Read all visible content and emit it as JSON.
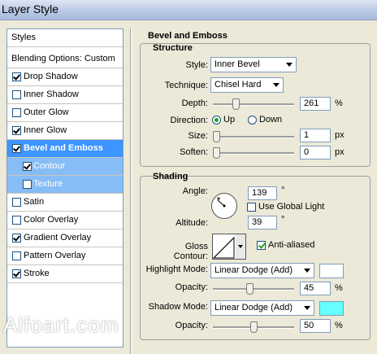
{
  "window": {
    "title": "Layer Style"
  },
  "styles_panel": {
    "header": "Styles",
    "blending": "Blending Options: Custom",
    "items": [
      {
        "label": "Drop Shadow",
        "checked": true
      },
      {
        "label": "Inner Shadow",
        "checked": false
      },
      {
        "label": "Outer Glow",
        "checked": false
      },
      {
        "label": "Inner Glow",
        "checked": true
      },
      {
        "label": "Bevel and Emboss",
        "checked": true,
        "selected": true
      },
      {
        "label": "Contour",
        "checked": true,
        "sub": true
      },
      {
        "label": "Texture",
        "checked": false,
        "sub": true
      },
      {
        "label": "Satin",
        "checked": false
      },
      {
        "label": "Color Overlay",
        "checked": false
      },
      {
        "label": "Gradient Overlay",
        "checked": true
      },
      {
        "label": "Pattern Overlay",
        "checked": false
      },
      {
        "label": "Stroke",
        "checked": true
      }
    ]
  },
  "bevel": {
    "title": "Bevel and Emboss",
    "structure": {
      "title": "Structure",
      "style_label": "Style:",
      "style_value": "Inner Bevel",
      "technique_label": "Technique:",
      "technique_value": "Chisel Hard",
      "depth_label": "Depth:",
      "depth_value": "261",
      "depth_unit": "%",
      "depth_fraction": 0.26,
      "direction_label": "Direction:",
      "direction_up": "Up",
      "direction_down": "Down",
      "size_label": "Size:",
      "size_value": "1",
      "size_unit": "px",
      "size_fraction": 0.0,
      "soften_label": "Soften:",
      "soften_value": "0",
      "soften_unit": "px",
      "soften_fraction": 0.0
    },
    "shading": {
      "title": "Shading",
      "angle_label": "Angle:",
      "angle_value": "139",
      "angle_unit": "°",
      "global_light_label": "Use Global Light",
      "global_light_checked": false,
      "altitude_label": "Altitude:",
      "altitude_value": "39",
      "altitude_unit": "°",
      "gloss_label": "Gloss Contour:",
      "anti_aliased_label": "Anti-aliased",
      "anti_aliased_checked": true,
      "highlight_mode_label": "Highlight Mode:",
      "highlight_mode_value": "Linear Dodge (Add)",
      "highlight_color": "#ffffff",
      "highlight_opacity_label": "Opacity:",
      "highlight_opacity_value": "45",
      "highlight_opacity_unit": "%",
      "highlight_opacity_fraction": 0.45,
      "shadow_mode_label": "Shadow Mode:",
      "shadow_mode_value": "Linear Dodge (Add)",
      "shadow_color": "#66ffff",
      "shadow_opacity_label": "Opacity:",
      "shadow_opacity_value": "50",
      "shadow_opacity_unit": "%",
      "shadow_opacity_fraction": 0.5
    }
  },
  "watermark": "Alfoart.com"
}
